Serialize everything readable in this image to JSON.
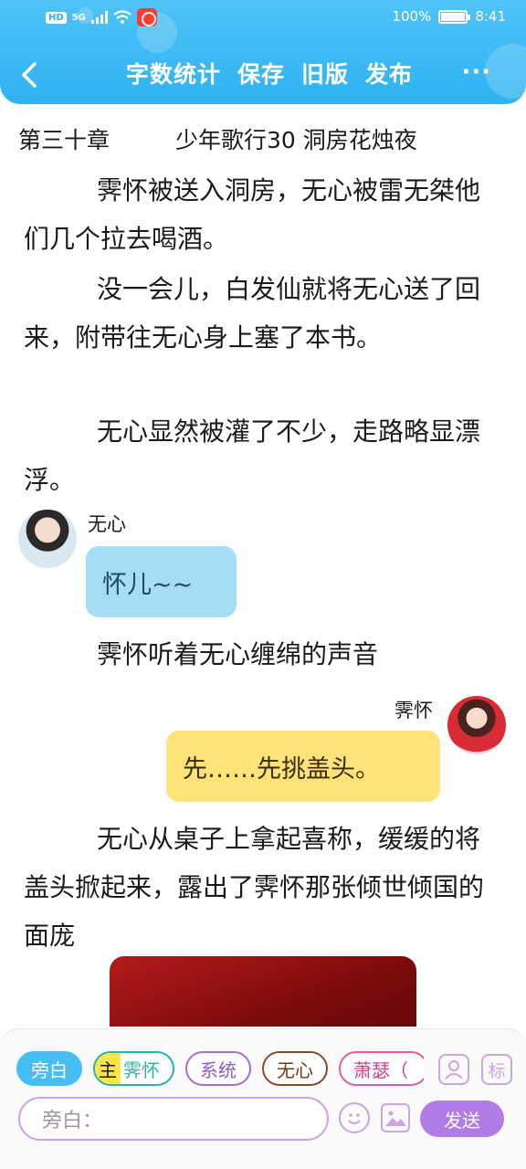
{
  "status_bar": {
    "network_badge": "HD",
    "network_type": "5G",
    "battery_percent": "100%",
    "time": "8:41"
  },
  "toolbar": {
    "word_count": "字数统计",
    "save": "保存",
    "old_version": "旧版",
    "publish": "发布",
    "more": "···"
  },
  "chapter": {
    "label": "第三十章",
    "title": "少年歌行30 洞房花烛夜"
  },
  "paragraphs": [
    "霁怀被送入洞房，无心被雷无桀他们几个拉去喝酒。",
    "没一会儿，白发仙就将无心送了回来，附带往无心身上塞了本书。",
    "无心显然被灌了不少，走路略显漂浮。",
    "霁怀听着无心缠绵的声音",
    "无心从桌子上拿起喜称，缓缓的将盖头掀起来，露出了霁怀那张倾世倾国的面庞"
  ],
  "messages": [
    {
      "speaker": "无心",
      "text": "怀儿~~",
      "color": "#a6dcf6"
    },
    {
      "speaker": "霁怀",
      "text": "先……先挑盖头。",
      "color": "#ffe278"
    }
  ],
  "roles": {
    "narration": "旁白",
    "main_tag": "主",
    "main_name": "霁怀",
    "system": "系统",
    "wuxin": "无心",
    "xiao": "萧瑟（"
  },
  "composer": {
    "placeholder": "旁白：",
    "mark_label": "标",
    "send": "发送"
  },
  "colors": {
    "header": "#2fb2f2",
    "accent": "#b27ce6"
  }
}
